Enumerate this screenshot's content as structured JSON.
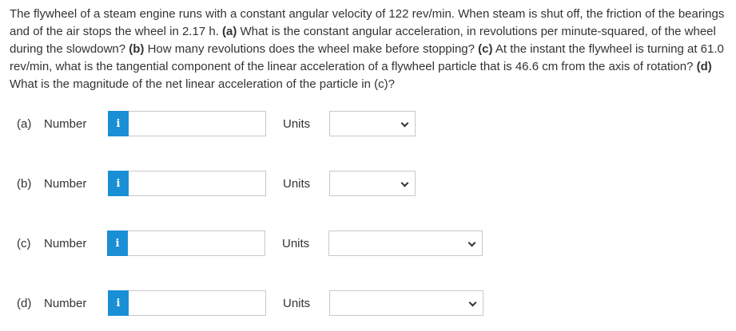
{
  "question": {
    "s1": "The flywheel of a steam engine runs with a constant angular velocity of 122 rev/min. When steam is shut off, the friction of the bearings and of the air stops the wheel in 2.17 h. ",
    "a_tag": "(a)",
    "a_text": " What is the constant angular acceleration, in revolutions per minute-squared, of the wheel during the slowdown? ",
    "b_tag": "(b)",
    "b_text": " How many revolutions does the wheel make before stopping? ",
    "c_tag": "(c)",
    "c_text": " At the instant the flywheel is turning at 61.0 rev/min, what is the tangential component of the linear acceleration of a flywheel particle that is 46.6 cm from the axis of rotation? ",
    "d_tag": "(d)",
    "d_text": " What is the magnitude of the net linear acceleration of the particle in (c)?"
  },
  "parts": [
    {
      "letter": "(a)",
      "number_label": "Number",
      "number_value": "",
      "info_icon": "info-icon",
      "units_label": "Units",
      "units_value": ""
    },
    {
      "letter": "(b)",
      "number_label": "Number",
      "number_value": "",
      "info_icon": "info-icon",
      "units_label": "Units",
      "units_value": ""
    },
    {
      "letter": "(c)",
      "number_label": "Number",
      "number_value": "",
      "info_icon": "info-icon",
      "units_label": "Units",
      "units_value": ""
    },
    {
      "letter": "(d)",
      "number_label": "Number",
      "number_value": "",
      "info_icon": "info-icon",
      "units_label": "Units",
      "units_value": ""
    }
  ],
  "info_glyph": "i",
  "colors": {
    "info_button": "#1a8fd6",
    "text": "#333333",
    "input_border": "#c8c8c8"
  }
}
